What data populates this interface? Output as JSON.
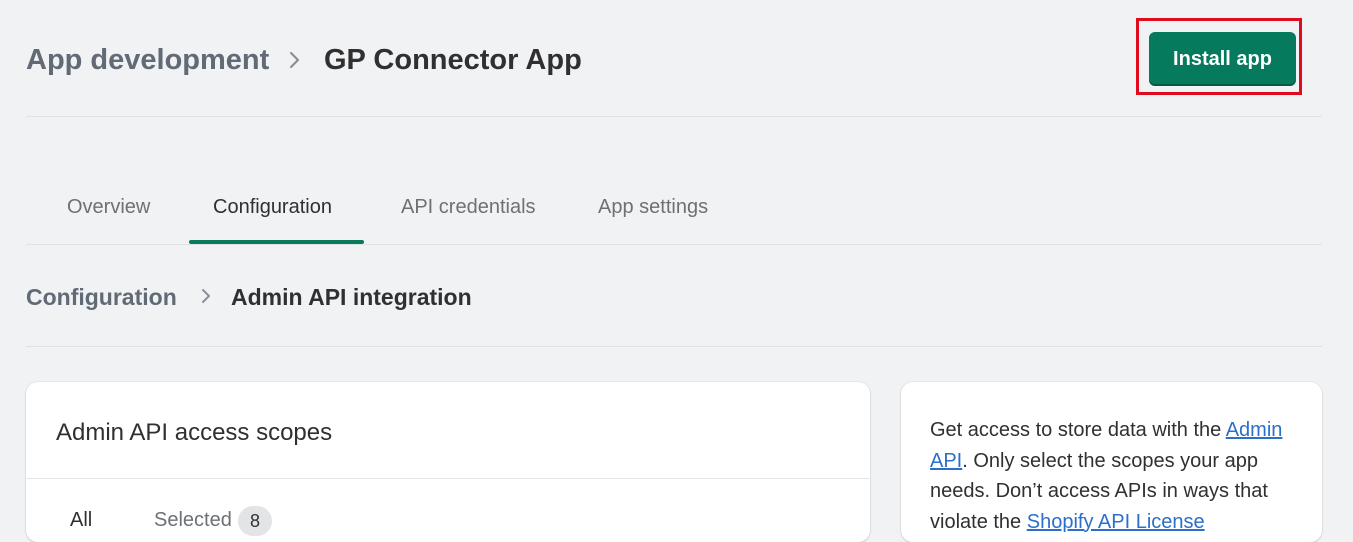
{
  "header": {
    "breadcrumb_parent": "App development",
    "breadcrumb_current": "GP Connector App",
    "install_button": "Install app",
    "install_button_color": "#067a5c",
    "highlight_color": "#e00b1c"
  },
  "tabs": [
    {
      "label": "Overview",
      "active": false
    },
    {
      "label": "Configuration",
      "active": true
    },
    {
      "label": "API credentials",
      "active": false
    },
    {
      "label": "App settings",
      "active": false
    }
  ],
  "subheader": {
    "breadcrumb_parent": "Configuration",
    "breadcrumb_current": "Admin API integration"
  },
  "scopes_card": {
    "title": "Admin API access scopes",
    "filters": {
      "all": "All",
      "selected": "Selected",
      "selected_count": "8"
    }
  },
  "info_card": {
    "text_1": "Get access to store data with the ",
    "link_1": "Admin API",
    "text_2": ". Only select the scopes your app needs. Don’t access APIs in ways that violate the ",
    "link_2": "Shopify API License"
  }
}
